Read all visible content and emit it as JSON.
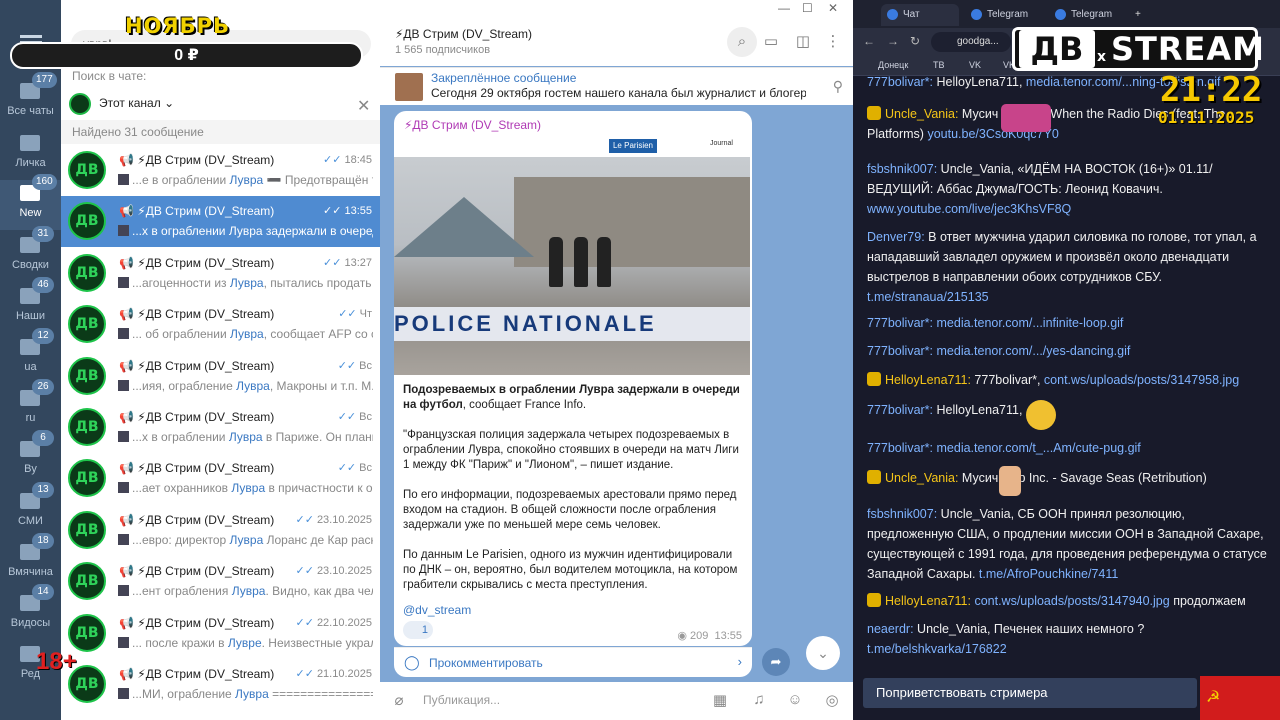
{
  "overlay": {
    "month": "НОЯБРЬ",
    "money": "0 ₽",
    "age": "18+"
  },
  "rail": {
    "folders": [
      {
        "label": "Все чаты",
        "badge": "177"
      },
      {
        "label": "Личка",
        "badge": ""
      },
      {
        "label": "New",
        "badge": "160"
      },
      {
        "label": "Сводки",
        "badge": "31"
      },
      {
        "label": "Наши",
        "badge": "46"
      },
      {
        "label": "ua",
        "badge": "12"
      },
      {
        "label": "ru",
        "badge": "26"
      },
      {
        "label": "By",
        "badge": "6"
      },
      {
        "label": "СМИ",
        "badge": "13"
      },
      {
        "label": "Вмячина",
        "badge": "18"
      },
      {
        "label": "Видосы",
        "badge": "14"
      },
      {
        "label": "Ред",
        "badge": ""
      }
    ]
  },
  "search": {
    "query": "уврв|",
    "in_chat_label": "Поиск в чате:",
    "scope": "Этот канал",
    "found": "Найдено 31 сообщение"
  },
  "results": [
    {
      "name": "📢 ⚡ДВ Стрим (DV_Stream)",
      "time": "18:45",
      "pre": "...е в ограблении ",
      "hl": "Лувра",
      "post": " ➖ Предотвращён т..."
    },
    {
      "name": "📢 ⚡ДВ Стрим (DV_Stream)",
      "time": "13:55",
      "pre": "...х в ограблении ",
      "hl": "Лувра",
      "post": " задержали в очеред..."
    },
    {
      "name": "📢 ⚡ДВ Стрим (DV_Stream)",
      "time": "13:27",
      "pre": "...агоценности из ",
      "hl": "Лувра",
      "post": ", пытались продать ..."
    },
    {
      "name": "📢 ⚡ДВ Стрим (DV_Stream)",
      "time": "Чт",
      "pre": "... об ограблении ",
      "hl": "Лувра",
      "post": ", сообщает AFP со сс..."
    },
    {
      "name": "📢 ⚡ДВ Стрим (DV_Stream)",
      "time": "Вс",
      "pre": "...ияя, ограбление ",
      "hl": "Лувра",
      "post": ", Макроны и т.п. М.Х..."
    },
    {
      "name": "📢 ⚡ДВ Стрим (DV_Stream)",
      "time": "Вс",
      "pre": "...х в ограблении ",
      "hl": "Лувра",
      "post": " в Париже. Он планиро..."
    },
    {
      "name": "📢 ⚡ДВ Стрим (DV_Stream)",
      "time": "Вс",
      "pre": "...ает охранников ",
      "hl": "Лувра",
      "post": " в причастности к ог..."
    },
    {
      "name": "📢 ⚡ДВ Стрим (DV_Stream)",
      "time": "23.10.2025",
      "pre": "...евро: директор ",
      "hl": "Лувра",
      "post": " Лоранс де Кар раск..."
    },
    {
      "name": "📢 ⚡ДВ Стрим (DV_Stream)",
      "time": "23.10.2025",
      "pre": "...ент ограбления ",
      "hl": "Лувра",
      "post": ". Видно, как два челов..."
    },
    {
      "name": "📢 ⚡ДВ Стрим (DV_Stream)",
      "time": "22.10.2025",
      "pre": "... после кражи в ",
      "hl": "Лувре",
      "post": ". Неизвестные украли к..."
    },
    {
      "name": "📢 ⚡ДВ Стрим (DV_Stream)",
      "time": "21.10.2025",
      "pre": "...МИ, ограбление ",
      "hl": "Лувра",
      "post": " ================="
    }
  ],
  "channel": {
    "title": "⚡ДВ Стрим (DV_Stream)",
    "subscribers": "1 565 подписчиков",
    "pinned_label": "Закреплённое сообщение",
    "pinned_text": "Сегодня 29 октября гостем нашего канала был журналист и блогер..."
  },
  "message": {
    "from": "⚡ДВ Стрим (DV_Stream)",
    "photo_source": "Le Parisien",
    "photo_journal": "Journal",
    "photo_tape": "POLICE NATIONALE",
    "headline": "Подозреваемых в ограблении Лувра задержали в очереди на футбол",
    "headline_tail": ", сообщает France Info.",
    "p1": "\"Французская полиция задержала четырех подозреваемых в ограблении Лувра, спокойно стоявших в очереди на матч Лиги 1 между ФК \"Париж\" и \"Лионом\", – пишет издание.",
    "p2": "По его информации, подозреваемых арестовали прямо перед входом на стадион. В общей сложности после ограбления задержали уже по меньшей мере семь человек.",
    "p3": "По данным Le Parisien, одного из мужчин идентифицировали по ДНК – он, вероятно, был водителем мотоцикла, на котором грабители скрывались с места преступления.",
    "tag": "@dv_stream",
    "reaction_count": "1",
    "views": "209",
    "time": "13:55",
    "comment_label": "Прокомментировать"
  },
  "composer": {
    "placeholder": "Публикация..."
  },
  "browser": {
    "tabs": [
      "Чат",
      "Telegram",
      "Telegram"
    ],
    "url": "goodga...",
    "bookmarks": [
      "Донецк",
      "ТВ",
      "VK",
      "VK Д"
    ]
  },
  "stream": {
    "logo_left": "ДВ",
    "logo_x": "x",
    "logo_right": "STREAM",
    "clock": "21:22",
    "date": "01.11.2025"
  },
  "chatlog": [
    {
      "user": "777bolivar*:",
      "text": " HelloyLena711, ",
      "link": "media.tenor.com/...ning-to-listen.gif"
    },
    {
      "user": "Uncle_Vania:",
      "text": " Мусич  Tholos - When the Radio Dies (feat. The Platforms) ",
      "link": "youtu.be/3CsoK0qc7Y0"
    },
    {
      "user": "fsbshnik007:",
      "text": " Uncle_Vania, «ИДЁМ НА ВОСТОК (16+)» 01.11/ ВЕДУЩИЙ: Аббас Джума/ГОСТЬ: Леонид Ковачич. ",
      "link": "www.youtube.com/live/jec3KhsVF8Q"
    },
    {
      "user": "Denver79:",
      "text": " В ответ мужчина ударил силовика по голове, тот упал, а нападавший завладел оружием и произвёл около двенадцати выстрелов в направлении обоих сотрудников СБУ. ",
      "link": "t.me/stranaua/215135"
    },
    {
      "user": "777bolivar*:",
      "text": " ",
      "link": "media.tenor.com/...infinite-loop.gif"
    },
    {
      "user": "777bolivar*:",
      "text": " ",
      "link": "media.tenor.com/.../yes-dancing.gif"
    },
    {
      "user": "HelloyLena711:",
      "text": " 777bolivar*, ",
      "link": "cont.ws/uploads/posts/3147958.jpg"
    },
    {
      "user": "777bolivar*:",
      "text": " HelloyLena711, ",
      "link": ""
    },
    {
      "user": "777bolivar*:",
      "text": " ",
      "link": "media.tenor.com/t_...Am/cute-pug.gif"
    },
    {
      "user": "Uncle_Vania:",
      "text": " Мусич  Grip Inc. - Savage Seas (Retribution)",
      "link": ""
    },
    {
      "user": "fsbshnik007:",
      "text": " Uncle_Vania, СБ ООН принял резолюцию, предложенную США, о продлении миссии ООН в Западной Сахаре, существующей с 1991 года, для проведения референдума о статусе Западной Сахары. ",
      "link": "t.me/AfroPouchkine/7411"
    },
    {
      "user": "HelloyLena711:",
      "text": " ",
      "link": "cont.ws/uploads/posts/3147940.jpg",
      "tail": " продолжаем"
    },
    {
      "user": "neaerdr:",
      "text": " Uncle_Vania, Печенек наших немного ? ",
      "link": "t.me/belshkvarka/176822"
    }
  ],
  "greet_button": "Поприветствовать стримера",
  "flag_symbol": "☭",
  "colors": {
    "accent": "#4f8bd1",
    "chat_bg": "#7fa6d4",
    "link": "#3a78c2",
    "overlay_yellow": "#f1d100"
  }
}
